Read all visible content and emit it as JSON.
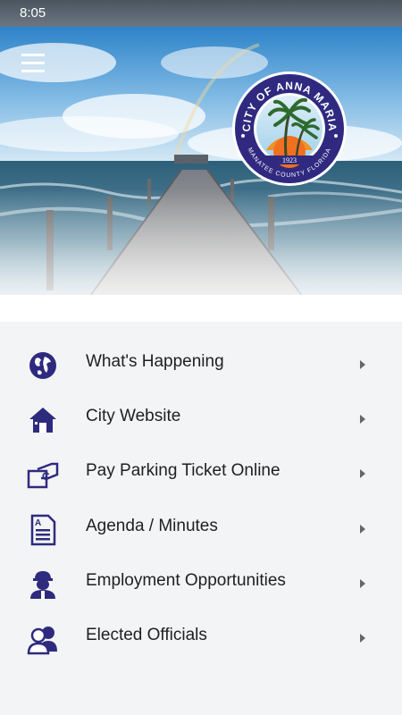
{
  "status_bar": {
    "time": "8:05"
  },
  "header": {
    "seal_top_text": "CITY OF ANNA MARIA",
    "seal_bottom_text": "MANATEE COUNTY FLORIDA",
    "seal_year": "1923"
  },
  "colors": {
    "accent": "#2e2a7e",
    "seal_blue": "#2f2a80"
  },
  "menu": {
    "items": [
      {
        "label": "What's Happening",
        "icon": "globe-icon"
      },
      {
        "label": "City Website",
        "icon": "home-icon"
      },
      {
        "label": "Pay Parking Ticket Online",
        "icon": "parking-ticket-icon"
      },
      {
        "label": "Agenda / Minutes",
        "icon": "document-icon"
      },
      {
        "label": "Employment Opportunities",
        "icon": "worker-icon"
      },
      {
        "label": "Elected Officials",
        "icon": "officials-icon"
      }
    ]
  }
}
